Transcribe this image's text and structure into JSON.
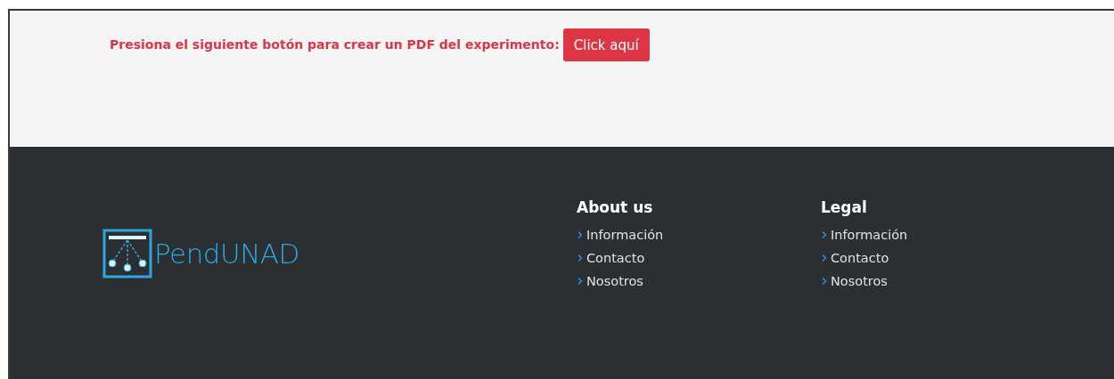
{
  "pdf_prompt": {
    "text": "Presiona el siguiente botón para crear un PDF del experimento:",
    "button": "Click aquí"
  },
  "footer": {
    "logo_text": "PendUNAD",
    "columns": [
      {
        "title": "About us",
        "links": [
          "Información",
          "Contacto",
          "Nosotros"
        ]
      },
      {
        "title": "Legal",
        "links": [
          "Información",
          "Contacto",
          "Nosotros"
        ]
      }
    ]
  }
}
